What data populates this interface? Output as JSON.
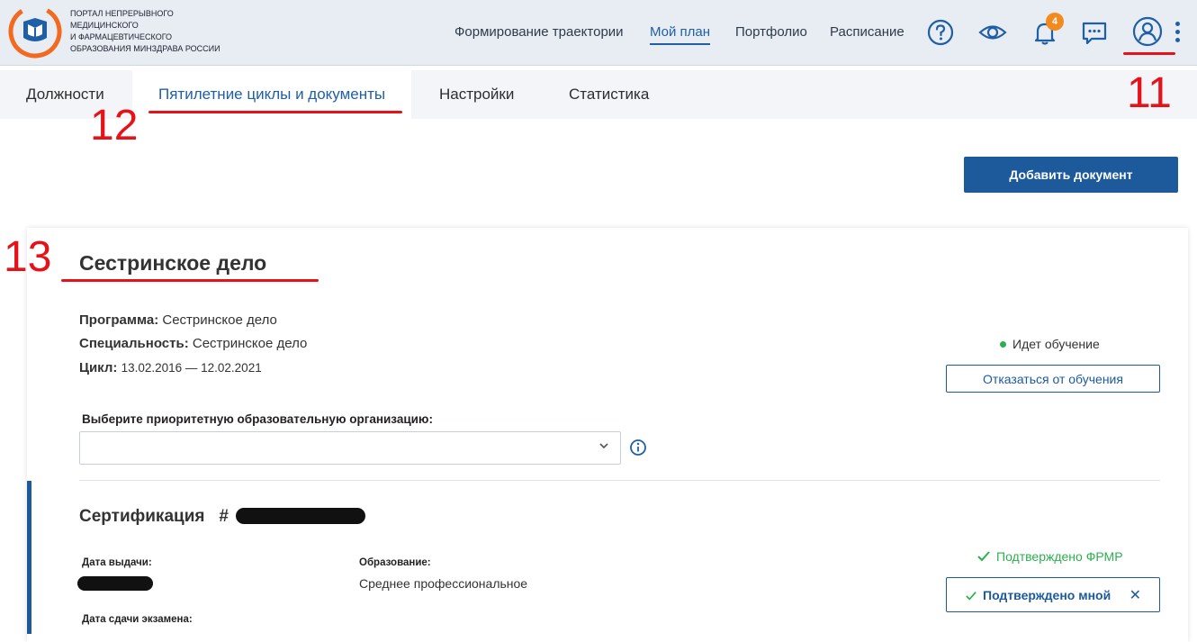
{
  "header": {
    "logo_lines": [
      "Портал непрерывного",
      "медицинского",
      "и фармацевтического",
      "образования Минздрава России"
    ],
    "nav": [
      {
        "label": "Формирование траектории",
        "active": false
      },
      {
        "label": "Мой план",
        "active": true
      },
      {
        "label": "Портфолио",
        "active": false
      },
      {
        "label": "Расписание",
        "active": false
      }
    ],
    "icons": [
      "help-icon",
      "eye-icon",
      "bell-icon",
      "chat-icon",
      "user-icon",
      "kebab-menu-icon"
    ],
    "notifications_count": "4",
    "accent_color": "#1c5a9c",
    "badge_color": "#f28a1e"
  },
  "tabs": [
    {
      "label": "Должности",
      "active": false
    },
    {
      "label": "Пятилетние циклы и документы",
      "active": true
    },
    {
      "label": "Настройки",
      "active": false
    },
    {
      "label": "Статистика",
      "active": false
    }
  ],
  "annotations": {
    "n11": "11",
    "n12": "12",
    "n13": "13",
    "color": "#e5121a"
  },
  "actions": {
    "add_document": "Добавить документ"
  },
  "card": {
    "title": "Сестринское дело",
    "program_label": "Программа:",
    "program_value": "Сестринское дело",
    "specialty_label": "Специальность:",
    "specialty_value": "Сестринское дело",
    "cycle_label": "Цикл:",
    "cycle_value": "13.02.2016 — 12.02.2021",
    "status": "Идет обучение",
    "status_color": "#2bb04f",
    "refuse_button": "Отказаться от обучения",
    "select_label": "Выберите приоритетную образовательную организацию:",
    "select_value": ""
  },
  "certification": {
    "title": "Сертификация",
    "number_prefix": "#",
    "issue_date_label": "Дата выдачи:",
    "education_label": "Образование:",
    "education_value": "Среднее профессиональное",
    "exam_date_label": "Дата сдачи экзамена:",
    "confirmed_frmr": "Подтверждено ФРМР",
    "confirmed_by_me": "Подтверждено мной"
  }
}
